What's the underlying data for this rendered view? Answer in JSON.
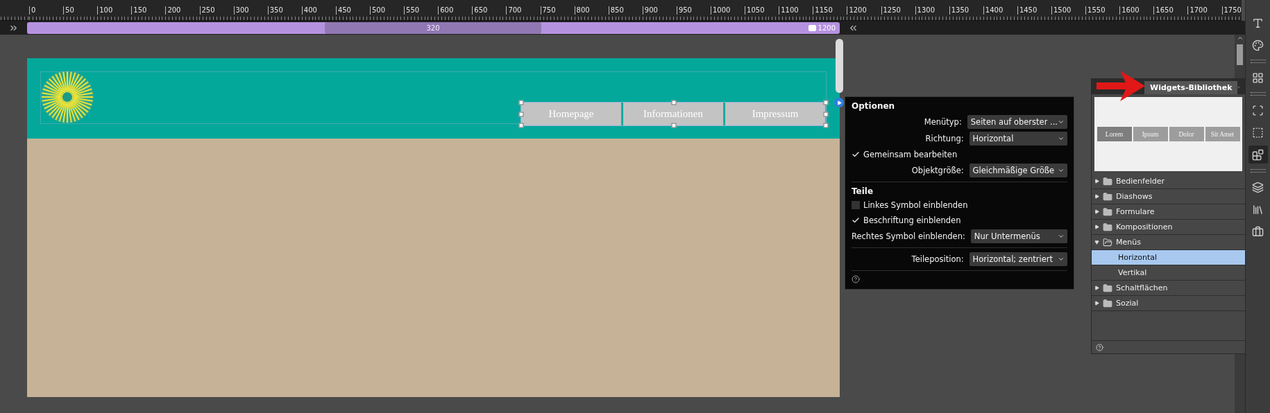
{
  "ruler": {
    "labels": [
      "0",
      "50",
      "100",
      "150",
      "200",
      "250",
      "300",
      "350",
      "400",
      "450",
      "500",
      "550",
      "600",
      "650",
      "700",
      "750",
      "800",
      "850",
      "900",
      "950",
      "1000",
      "1050",
      "1100",
      "1150",
      "1200",
      "1250",
      "1300",
      "1350",
      "1400",
      "1450",
      "1500",
      "1550",
      "1600",
      "1650",
      "1700",
      "1750"
    ]
  },
  "breakpoints": {
    "range_label": "320",
    "end_label": "1200"
  },
  "page": {
    "menu_items": [
      {
        "label": "Homepage"
      },
      {
        "label": "Informationen"
      },
      {
        "label": "Impressum"
      }
    ]
  },
  "options": {
    "title": "Optionen",
    "rows": [
      {
        "kind": "select",
        "label": "Menütyp:",
        "value": "Seiten auf oberster ..."
      },
      {
        "kind": "select",
        "label": "Richtung:",
        "value": "Horizontal"
      },
      {
        "kind": "checkbox",
        "label": "Gemeinsam bearbeiten",
        "checked": true
      },
      {
        "kind": "select",
        "label": "Objektgröße:",
        "value": "Gleichmäßige Größe"
      },
      {
        "kind": "divider"
      },
      {
        "kind": "heading",
        "label": "Teile"
      },
      {
        "kind": "checkbox",
        "label": "Linkes Symbol einblenden",
        "checked": false
      },
      {
        "kind": "checkbox",
        "label": "Beschriftung einblenden",
        "checked": true
      },
      {
        "kind": "select",
        "label": "Rechtes Symbol einblenden:",
        "value": "Nur Untermenüs"
      },
      {
        "kind": "divider"
      },
      {
        "kind": "select",
        "label": "Teileposition:",
        "value": "Horizontal; zentriert"
      },
      {
        "kind": "divider"
      }
    ]
  },
  "library": {
    "title": "Widgets-Bibliothek",
    "preview_items": [
      {
        "label": "Lorem",
        "selected": true
      },
      {
        "label": "Ipsum",
        "selected": false
      },
      {
        "label": "Dolor",
        "selected": false
      },
      {
        "label": "Sit Amet",
        "selected": false
      }
    ],
    "tree": [
      {
        "label": "Bedienfelder",
        "expanded": false,
        "selected": false
      },
      {
        "label": "Diashows",
        "expanded": false,
        "selected": false
      },
      {
        "label": "Formulare",
        "expanded": false,
        "selected": false
      },
      {
        "label": "Kompositionen",
        "expanded": false,
        "selected": false
      },
      {
        "label": "Menüs",
        "expanded": true,
        "selected": false,
        "children": [
          {
            "label": "Horizontal",
            "selected": true
          },
          {
            "label": "Vertikal",
            "selected": false
          }
        ]
      },
      {
        "label": "Schaltflächen",
        "expanded": false,
        "selected": false
      },
      {
        "label": "Sozial",
        "expanded": false,
        "selected": false
      }
    ]
  }
}
